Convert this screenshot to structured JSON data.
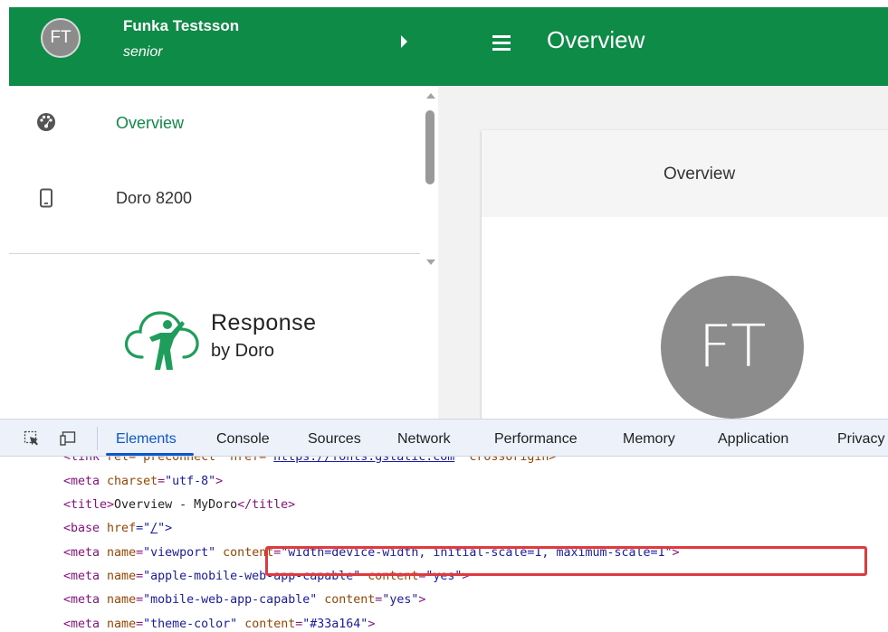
{
  "user": {
    "initials": "FT",
    "name": "Funka Testsson",
    "role": "senior"
  },
  "topbar": {
    "title": "Overview"
  },
  "nav": {
    "items": [
      {
        "label": "Overview",
        "icon": "dashboard-gauge-icon",
        "active": true
      },
      {
        "label": "Doro 8200",
        "icon": "phone-icon",
        "active": false
      }
    ]
  },
  "brand": {
    "name": "Response",
    "sub": "by Doro"
  },
  "card": {
    "title": "Overview",
    "avatar_initials": "FT"
  },
  "devtools": {
    "tabs": [
      "Elements",
      "Console",
      "Sources",
      "Network",
      "Performance",
      "Memory",
      "Application",
      "Privacy"
    ],
    "active_tab": "Elements",
    "lines": {
      "l0": {
        "tag_open": "<link ",
        "attr": "rel=\"preconnect\" href=\"",
        "link": "https://fonts.gstatic.com",
        "rest": "\" crossorigin>"
      },
      "l1": {
        "tag": "<meta ",
        "attr": "charset",
        "val": "\"utf-8\"",
        "close": ">"
      },
      "l2": {
        "open": "<title>",
        "text": "Overview - MyDoro",
        "close": "</title>"
      },
      "l3": {
        "tag": "<base ",
        "attr": "href",
        "eq": "=\"",
        "link": "/",
        "close": "\">"
      },
      "l4": {
        "tag": "<meta ",
        "attr1": "name",
        "val1": "\"viewport\"",
        "attr2": "content",
        "val2": "\"width=device-width, initial-scale=1, maximum-scale=1\"",
        "close": ">"
      },
      "l5": {
        "tag": "<meta ",
        "attr1": "name",
        "val1": "\"apple-mobile-web-app-capable\"",
        "attr2": "content",
        "val2": "\"yes\"",
        "close": ">"
      },
      "l6": {
        "tag": "<meta ",
        "attr1": "name",
        "val1": "\"mobile-web-app-capable\"",
        "attr2": "content",
        "val2": "\"yes\"",
        "close": ">"
      },
      "l7": {
        "tag": "<meta ",
        "attr1": "name",
        "val1": "\"theme-color\"",
        "attr2": "content",
        "val2": "\"#33a164\"",
        "close": ">"
      }
    }
  },
  "colors": {
    "brand_green": "#0e8b46",
    "nav_active": "#0e8b46",
    "highlight_border": "#e0393e",
    "devtools_active": "#0b57d0"
  }
}
